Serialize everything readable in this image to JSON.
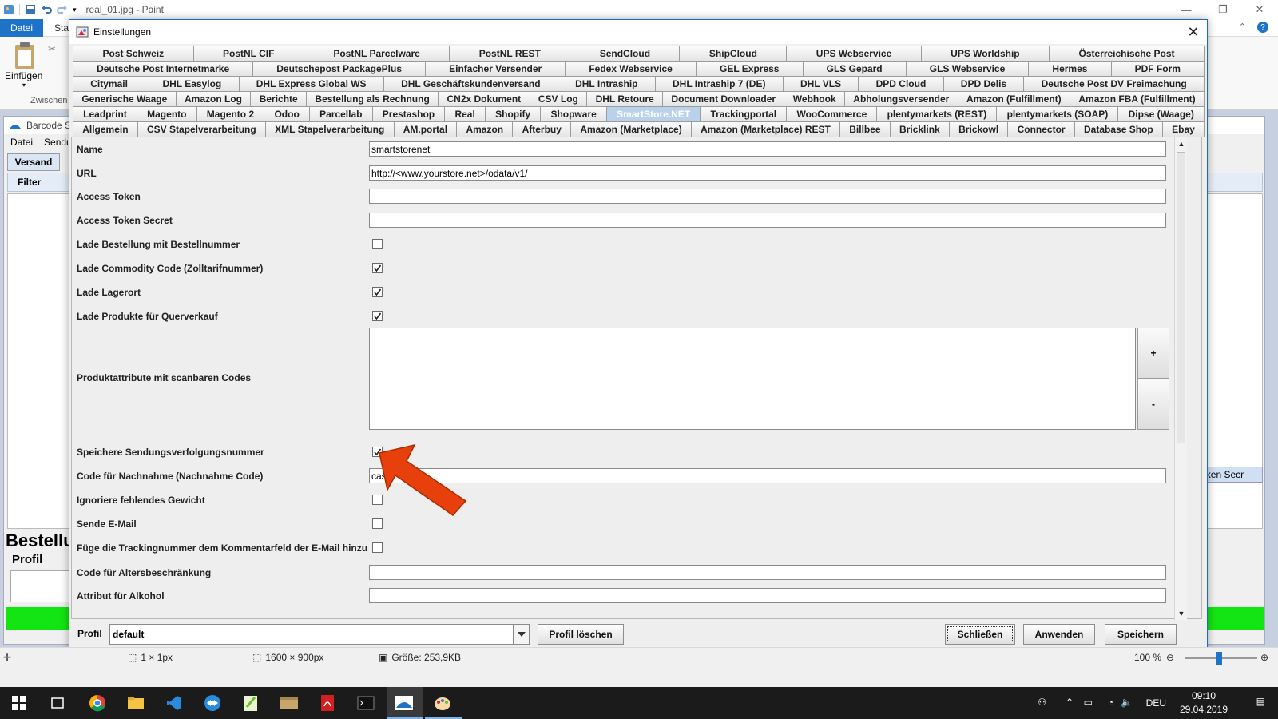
{
  "paint": {
    "title": "real_01.jpg - Paint",
    "tab_file": "Datei",
    "tab_start": "Sta",
    "paste_label": "Einfügen",
    "clipboard_label": "Zwischen",
    "status": {
      "selection": "1 × 1px",
      "dimensions": "1600 × 900px",
      "size": "Größe: 253,9KB",
      "zoom": "100 %"
    }
  },
  "bg_app": {
    "title": "Barcode Sh",
    "menu": [
      "Datei",
      "Sendu"
    ],
    "tab_versand": "Versand",
    "filter": "Filter",
    "heading": "Bestellu",
    "profile_label": "Profil",
    "token_label": "s Token Secr",
    "col_header": "m"
  },
  "dialog": {
    "title": "Einstellungen",
    "tab_rows": [
      [
        "Post Schweiz",
        "PostNL CIF",
        "PostNL Parcelware",
        "PostNL REST",
        "SendCloud",
        "ShipCloud",
        "UPS Webservice",
        "UPS Worldship",
        "Österreichische Post"
      ],
      [
        "Deutsche Post Internetmarke",
        "Deutschepost PackagePlus",
        "Einfacher Versender",
        "Fedex Webservice",
        "GEL Express",
        "GLS Gepard",
        "GLS Webservice",
        "Hermes",
        "PDF Form"
      ],
      [
        "Citymail",
        "DHL Easylog",
        "DHL Express Global WS",
        "DHL Geschäftskundenversand",
        "DHL Intraship",
        "DHL Intraship 7 (DE)",
        "DHL VLS",
        "DPD Cloud",
        "DPD Delis",
        "Deutsche Post DV Freimachung"
      ],
      [
        "Generische Waage",
        "Amazon Log",
        "Berichte",
        "Bestellung als Rechnung",
        "CN2x Dokument",
        "CSV Log",
        "DHL Retoure",
        "Document Downloader",
        "Webhook",
        "Abholungsversender",
        "Amazon (Fulfillment)",
        "Amazon FBA (Fulfillment)"
      ],
      [
        "Leadprint",
        "Magento",
        "Magento 2",
        "Odoo",
        "Parcellab",
        "Prestashop",
        "Real",
        "Shopify",
        "Shopware",
        "SmartStore.NET",
        "Trackingportal",
        "WooCommerce",
        "plentymarkets (REST)",
        "plentymarkets (SOAP)",
        "Dipse (Waage)"
      ],
      [
        "Allgemein",
        "CSV Stapelverarbeitung",
        "XML Stapelverarbeitung",
        "AM.portal",
        "Amazon",
        "Afterbuy",
        "Amazon (Marketplace)",
        "Amazon (Marketplace) REST",
        "Billbee",
        "Bricklink",
        "Brickowl",
        "Connector",
        "Database Shop",
        "Ebay"
      ]
    ],
    "active_tab": "SmartStore.NET",
    "fields": {
      "name_label": "Name",
      "name_value": "smartstorenet",
      "url_label": "URL",
      "url_value": "http://<www.yourstore.net>/odata/v1/",
      "access_token_label": "Access Token",
      "access_token_value": "",
      "access_token_secret_label": "Access Token Secret",
      "access_token_secret_value": "",
      "lade_bestellung_label": "Lade Bestellung mit Bestellnummer",
      "lade_commodity_label": "Lade Commodity Code (Zolltarifnummer)",
      "lade_lagerort_label": "Lade Lagerort",
      "lade_produkte_label": "Lade Produkte für Querverkauf",
      "produktattribute_label": "Produktattribute mit scanbaren Codes",
      "add_btn": "+",
      "remove_btn": "-",
      "speichere_label": "Speichere Sendungsverfolgungsnummer",
      "nachnahme_label": "Code für Nachnahme (Nachnahme Code)",
      "nachnahme_value": "cas",
      "ignoriere_label": "Ignoriere fehlendes Gewicht",
      "sende_email_label": "Sende E-Mail",
      "fuege_label": "Füge die Trackingnummer dem Kommentarfeld der E-Mail hinzu",
      "alters_label": "Code für Altersbeschränkung",
      "alters_value": "",
      "alkohol_label": "Attribut für Alkohol",
      "alkohol_value": ""
    },
    "checkboxes": {
      "lade_bestellung": false,
      "lade_commodity": true,
      "lade_lagerort": true,
      "lade_produkte": true,
      "speichere": true,
      "ignoriere": false,
      "sende_email": false,
      "fuege": false
    },
    "bottom": {
      "profile_label": "Profil",
      "profile_value": "default",
      "delete_profile": "Profil löschen",
      "close": "Schließen",
      "apply": "Anwenden",
      "save": "Speichern"
    }
  },
  "taskbar": {
    "language": "DEU",
    "time": "09:10",
    "date": "29.04.2019"
  },
  "colors": {
    "accent_blue": "#1e73c8",
    "active_tab": "#b9d1ea",
    "annotation_arrow": "#e8400c",
    "status_green": "#13e413"
  }
}
